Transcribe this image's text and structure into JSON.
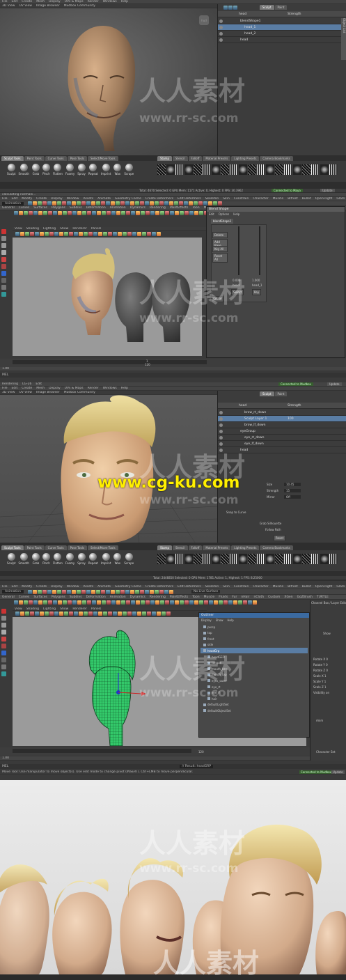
{
  "panel1": {
    "menu": [
      "File",
      "Edit",
      "Create",
      "Mesh",
      "Display",
      "UVs & Maps",
      "Render",
      "Windows",
      "Help"
    ],
    "view_tabs": [
      "3D View",
      "UV View",
      "Image Browser",
      "Mudbox Community"
    ],
    "hud": "hud",
    "layers": {
      "tabs": [
        "Sculpt",
        "Paint"
      ],
      "header": {
        "name": "head",
        "strength": "Strength"
      },
      "rows": [
        {
          "name": "blendShape1",
          "value": "",
          "indent": 0,
          "selected": false
        },
        {
          "name": "head_1",
          "value": "",
          "indent": 1,
          "selected": true
        },
        {
          "name": "head_2",
          "value": "",
          "indent": 1,
          "selected": false
        },
        {
          "name": "head",
          "value": "",
          "indent": 0,
          "selected": false
        }
      ],
      "side_tab": "Object List"
    },
    "sculpt_tabs": [
      "Sculpt Tools",
      "Paint Tools",
      "Curve Tools",
      "Pose Tools",
      "Select/Move Tools"
    ],
    "sculpt_tools": [
      "Sculpt",
      "Smooth",
      "Grab",
      "Pinch",
      "Flatten",
      "Foamy",
      "Spray",
      "Repeat",
      "Imprint",
      "Wax",
      "Scrape"
    ],
    "stamp_tabs": [
      "Stamp",
      "Stencil",
      "Falloff",
      "Material Presets",
      "Lighting Presets",
      "Camera Bookmarks"
    ],
    "status": "Total: 4670  Selected: 0  GPU Mem: 1171  Active: 0, Highest: 0  FPS: 30.3962",
    "connect_status": "Connected to Maya",
    "update_button": "Update"
  },
  "panel2": {
    "status_left": "calculating normals...",
    "menu": [
      "File",
      "Edit",
      "Modify",
      "Create",
      "Display",
      "Window",
      "Assets",
      "Animate",
      "Geometry Cache",
      "Create Deformers",
      "Edit Deformers",
      "Skeleton",
      "Skin",
      "Constrain",
      "Character",
      "Muscle",
      "Bifrost",
      "Bullet",
      "OpenFlight",
      "Glam",
      "Pipeline Cache",
      "Help"
    ],
    "mode": "Animation",
    "shelf_tabs": [
      "General",
      "Curves",
      "Surfaces",
      "Polygons",
      "Subdivs",
      "Deformation",
      "Animation",
      "Dynamics",
      "Rendering",
      "PaintEffects",
      "Toon",
      "Muscle",
      "Fluids",
      "Fur",
      "nHair",
      "nCloth",
      "Custom"
    ],
    "viewport_menu": [
      "View",
      "Shading",
      "Lighting",
      "Show",
      "Renderer",
      "Panels"
    ],
    "blend_window": {
      "title": "Blend Shape",
      "menu": [
        "Edit",
        "Options",
        "Help"
      ],
      "node": "blendShape1",
      "buttons": [
        "Delete",
        "Add Base",
        "Key All",
        "Reset All"
      ],
      "values": [
        "0.000",
        "1.000"
      ],
      "labels": [
        "head",
        "head_1"
      ],
      "slider_buttons": [
        "Select",
        "Key"
      ],
      "select_btn": "Select"
    },
    "timeline_start": "1.00",
    "timeline_mid": "1",
    "timeline_end": "120",
    "cmd_label": "MEL"
  },
  "panel3": {
    "top_menu": [
      "Rendering",
      "LG-26",
      "Edit"
    ],
    "connect_status": "Connected to Mudbox",
    "update_button": "Update",
    "menu": [
      "File",
      "Edit",
      "Create",
      "Mesh",
      "Display",
      "UVs & Maps",
      "Render",
      "Windows",
      "Help"
    ],
    "view_tabs": [
      "3D View",
      "UV View",
      "Image Browser",
      "Mudbox Community"
    ],
    "layers": {
      "tabs": [
        "Sculpt",
        "Paint"
      ],
      "header": {
        "name": "head",
        "strength": "Strength"
      },
      "rows": [
        {
          "name": "brow_rt_down",
          "value": "",
          "indent": 1,
          "selected": false
        },
        {
          "name": "Sculpt Layer 1",
          "value": "100",
          "indent": 1,
          "selected": true
        },
        {
          "name": "brow_lf_down",
          "value": "",
          "indent": 1,
          "selected": false
        },
        {
          "name": "eyeGroup",
          "value": "",
          "indent": 0,
          "selected": false
        },
        {
          "name": "eye_rt_down",
          "value": "",
          "indent": 1,
          "selected": false
        },
        {
          "name": "eye_lf_down",
          "value": "",
          "indent": 1,
          "selected": false
        },
        {
          "name": "head",
          "value": "",
          "indent": 0,
          "selected": false
        }
      ]
    },
    "props": {
      "rows": [
        {
          "label": "Size",
          "value": "10.45"
        },
        {
          "label": "Strength",
          "value": "15"
        },
        {
          "label": "Mirror",
          "value": "Off"
        }
      ],
      "snap": "Snap to Curve",
      "silhouette": "Grab Silhouette",
      "follow": "Follow Path",
      "reset": "Reset"
    },
    "sculpt_tabs": [
      "Sculpt Tools",
      "Paint Tools",
      "Curve Tools",
      "Pose Tools",
      "Select/Move Tools"
    ],
    "sculpt_tools": [
      "Sculpt",
      "Smooth",
      "Grab",
      "Pinch",
      "Flatten",
      "Foamy",
      "Spray",
      "Repeat",
      "Imprint",
      "Wax",
      "Scrape"
    ],
    "stamp_tabs": [
      "Stamp",
      "Stencil",
      "Falloff",
      "Material Presets",
      "Lighting Presets",
      "Camera Bookmarks"
    ],
    "status": "Total: 2446850  Selected: 0  GPU Mem: 1781  Active: 1, Highest: 1  FPS: 8.25000"
  },
  "panel4": {
    "menu": [
      "File",
      "Edit",
      "Modify",
      "Create",
      "Display",
      "Window",
      "Assets",
      "Animate",
      "Geometry Cache",
      "Create Deformers",
      "Edit Deformers",
      "Skeleton",
      "Skin",
      "Constrain",
      "Character",
      "Muscle",
      "Bifrost",
      "Bullet",
      "OpenFlight",
      "Glam",
      "Pipeline Cache",
      "Help"
    ],
    "mode": "Animation",
    "shelf_tabs": [
      "General",
      "Curves",
      "Surfaces",
      "Polygons",
      "Subdivs",
      "Deformation",
      "Animation",
      "Dynamics",
      "Rendering",
      "PaintEffects",
      "Toon",
      "Muscle",
      "Fluids",
      "Fur",
      "nHair",
      "nCloth",
      "Custom",
      "XGen",
      "GoZBrush",
      "TURTLE"
    ],
    "viewport_menu": [
      "View",
      "Shading",
      "Lighting",
      "Show",
      "Renderer",
      "Panels"
    ],
    "no_live": "No Live Surface",
    "outliner": {
      "title": "Outliner",
      "menu": [
        "Display",
        "Show",
        "Help"
      ],
      "items": [
        {
          "name": "persp",
          "indent": 0,
          "selected": false
        },
        {
          "name": "top",
          "indent": 0,
          "selected": false
        },
        {
          "name": "front",
          "indent": 0,
          "selected": false
        },
        {
          "name": "side",
          "indent": 0,
          "selected": false
        },
        {
          "name": "headGrp",
          "indent": 0,
          "selected": true
        },
        {
          "name": "headGEO",
          "indent": 1,
          "selected": false
        },
        {
          "name": "tongue",
          "indent": 1,
          "selected": false
        },
        {
          "name": "mouth_btm",
          "indent": 1,
          "selected": false
        },
        {
          "name": "mouth_top",
          "indent": 1,
          "selected": false
        },
        {
          "name": "eyes_outer",
          "indent": 1,
          "selected": false
        },
        {
          "name": "eye_rt",
          "indent": 1,
          "selected": false
        },
        {
          "name": "eye_lf",
          "indent": 1,
          "selected": false
        },
        {
          "name": "hair",
          "indent": 1,
          "selected": false
        },
        {
          "name": "defaultLightSet",
          "indent": 0,
          "selected": false
        },
        {
          "name": "defaultObjectSet",
          "indent": 0,
          "selected": false
        }
      ]
    },
    "channel_title": "Channel Box / Layer Editor",
    "channel_show": "Show",
    "channels": [
      "Rotate X 0",
      "Rotate Y 0",
      "Rotate Z 0",
      "Scale X 1",
      "Scale Y 1",
      "Scale Z 1",
      "Visibility on"
    ],
    "anim": "Anim",
    "character_set": "Character Set",
    "result": "// Result: headGRP",
    "help": "Move Tool: Use manipulator to move object(s). Use edit mode to change pivot (INSERT). Ctrl+LMB to move perpendicular.",
    "connect_status": "Connected to Mudbox",
    "update_button": "Update",
    "timeline_start": "1.00",
    "timeline_end": "120",
    "cmd_label": "MEL"
  },
  "watermarks": {
    "cn": "人人素材",
    "domain1": "www.rr-sc.com",
    "domain2": "www.cg-ku.com"
  },
  "colors": {
    "skin": "#c9a07a",
    "hair": "#d9c47a",
    "wire": "#33d06a",
    "selected": "#5a7da4",
    "watermark_yellow": "#ffef00"
  }
}
